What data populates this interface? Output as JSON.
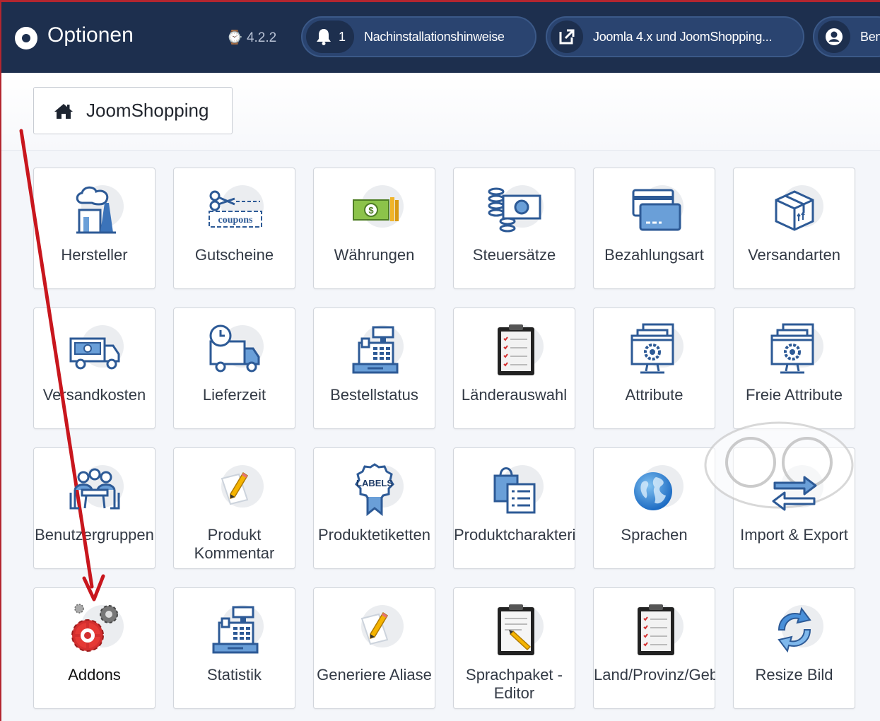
{
  "header": {
    "title": "Optionen",
    "version": "4.2.2",
    "notifications": {
      "count": "1",
      "label": "Nachinstallationshinweise"
    },
    "link": {
      "label": "Joomla 4.x und JoomShopping..."
    },
    "user": {
      "label": "Ben"
    }
  },
  "breadcrumb": {
    "home_label": "JoomShopping"
  },
  "tiles": [
    {
      "label": "Hersteller",
      "icon": "factory-icon"
    },
    {
      "label": "Gutscheine",
      "icon": "coupon-scissors-icon",
      "icon_text": "coupons"
    },
    {
      "label": "Währungen",
      "icon": "money-bill-icon"
    },
    {
      "label": "Steuersätze",
      "icon": "coins-bill-icon"
    },
    {
      "label": "Bezahlungsart",
      "icon": "credit-card-icon"
    },
    {
      "label": "Versandarten",
      "icon": "package-icon"
    },
    {
      "label": "Versandkosten",
      "icon": "delivery-truck-money-icon"
    },
    {
      "label": "Lieferzeit",
      "icon": "delivery-truck-clock-icon"
    },
    {
      "label": "Bestellstatus",
      "icon": "cash-register-icon"
    },
    {
      "label": "Länderauswahl",
      "icon": "clipboard-checklist-icon"
    },
    {
      "label": "Attribute",
      "icon": "monitor-gear-icon"
    },
    {
      "label": "Freie Attribute",
      "icon": "monitor-gear-icon"
    },
    {
      "label": "Benutzergruppen",
      "icon": "user-group-icon"
    },
    {
      "label": "Produkt Kommentar",
      "icon": "pencil-note-icon"
    },
    {
      "label": "Produktetiketten",
      "icon": "labels-badge-icon",
      "icon_text": "LABELS"
    },
    {
      "label": "Produktcharakteristiken",
      "icon": "shopping-bag-list-icon"
    },
    {
      "label": "Sprachen",
      "icon": "globe-icon"
    },
    {
      "label": "Import & Export",
      "icon": "exchange-arrows-icon"
    },
    {
      "label": "Addons",
      "icon": "red-gears-icon"
    },
    {
      "label": "Statistik",
      "icon": "cash-register-icon"
    },
    {
      "label": "Generiere Aliase",
      "icon": "pencil-note-icon"
    },
    {
      "label": "Sprachpaket - Editor",
      "icon": "clipboard-pencil-icon"
    },
    {
      "label": "Land/Provinz/Gebiet",
      "icon": "clipboard-checklist-icon"
    },
    {
      "label": "Resize Bild",
      "icon": "refresh-arrows-icon"
    }
  ],
  "colors": {
    "header_bg": "#1d2f4e",
    "accent_red": "#b3262f",
    "icon_blue": "#3b73b9",
    "annotation_arrow": "#c8161d"
  }
}
